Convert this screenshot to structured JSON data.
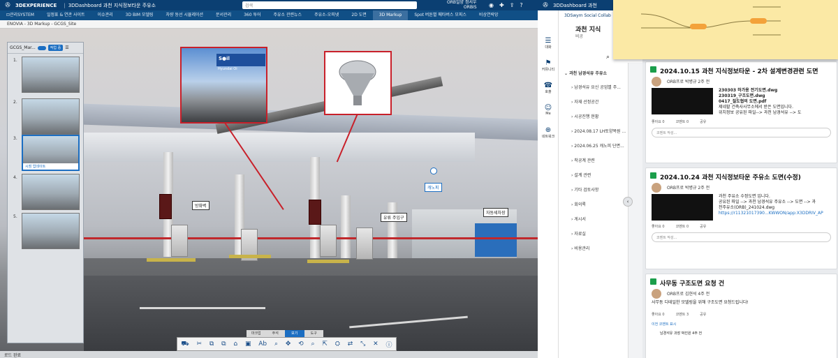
{
  "left_app": {
    "brand": "3DEXPERIENCE",
    "sep": "|",
    "dashboard": "3DDashboard 과천 지식정보타운 주유소",
    "search_placeholder": "검색",
    "user_line1": "ORB일양 정서우",
    "user_line2": "ORBIS",
    "tabs": [
      "⊡관리SYSTEM",
      "일정표 & 연관 사이트",
      "이슈관리",
      "3D BIM 모델링",
      "차량 동선 시뮬레이션",
      "문서관리",
      "360 투어",
      "주유소 관련뉴스",
      "주유소-오피넷",
      "2D 도면",
      "3D Markup",
      "Spot 버튼별 메타버스 모피스",
      "비상연락망"
    ],
    "active_tab": "3D Markup",
    "breadcrumb": "ENOVIA - 3D Markup - GCGS_Site",
    "panel_title": "GCGS_Mar...",
    "panel_button": "작업 중",
    "thumbs": [
      {
        "num": "1."
      },
      {
        "num": "2."
      },
      {
        "num": "3.",
        "caption": "시점 업데이트"
      },
      {
        "num": "4."
      },
      {
        "num": "5."
      }
    ],
    "labels": {
      "firewall": "방화벽",
      "canopy": "캐노피",
      "inlet": "유류 주입구",
      "carwash": "자동세차장"
    },
    "callout_station_sign": "S●il",
    "callout_station_brand": "Hyundai Oi",
    "toolbar_tabs": [
      "마크업",
      "주석",
      "보기",
      "도구"
    ],
    "active_toolbar_tab": "보기",
    "toolbar_icons": [
      "⛟",
      "✂",
      "⧉",
      "⧉",
      "⌂",
      "▣",
      "Ab",
      "⌕",
      "✥",
      "⟲",
      "⌕",
      "⇱",
      "⛭",
      "⇄",
      "⤡",
      "✕",
      "ⓘ"
    ],
    "status": "로드 완료"
  },
  "right_app": {
    "topbar_title": "3DDashboard 과천",
    "social_title": "3DSwym Social Collab",
    "community_title": "과천 지식",
    "community_sub": "비공",
    "rail": [
      {
        "icon": "☰",
        "label": "대화"
      },
      {
        "icon": "⚑",
        "label": "커뮤니티"
      },
      {
        "icon": "☎",
        "label": "호출"
      },
      {
        "icon": "☺",
        "label": "Me"
      },
      {
        "icon": "⊕",
        "label": "네트워크"
      }
    ],
    "nav_root": "과천 남경석유 주유소",
    "nav_items": [
      "남경석유 요신 공업별 주...",
      "자재 선정공간",
      "시공진행 현황",
      "2024.08.17 LH토양복원 ...",
      "2024.06.25 캐노피 단면...",
      "착공계 관련",
      "설계 관련",
      "기타 검토사항",
      "회의록",
      "게시서",
      "자료실",
      "비용관리"
    ],
    "posts": [
      {
        "title": "2024.10.15 과천 지식정보타운 - 2차 설계변경관련 도면",
        "author": "ORB프로 박병규",
        "time": "2주 전",
        "lines": [
          "230303 하가용 전기도면.dwg",
          "230319_구조도면.dwg",
          "0417_질도협의 도면.pdf",
          "제네할 건축사사무소에서 받은 도면입니다.",
          "위치정보 공유된 파일--> 과천 남경석유 --> 도"
        ],
        "likes": "좋아요 0",
        "comments": "코멘트 0",
        "share": "공유",
        "comment_placeholder": "코멘트 작성..."
      },
      {
        "title": "2024.10.24 과천 지식정보타운 주유소 도면(수정)",
        "author": "ORB프로 박병규",
        "time": "2주 전",
        "lines": [
          "과천 주유소 수정도면 입니다.",
          "공유된 파일 --> 과천 남경석유 주유소 --> 도면 --> 과",
          "천주유소(ORB)_241024.dwg"
        ],
        "link": "https://r1132101739​0...KWWON/app:X3DDRIV_AP",
        "likes": "좋아요 0",
        "comments": "코멘트 0",
        "share": "공유",
        "comment_placeholder": "코멘트 작성..."
      },
      {
        "title": "사무동 구조도면 요청 건",
        "author": "ORB프로 김현석",
        "time": "4주 전",
        "lines": [
          "사무동 디테일한 모델링을 위해 구조도면 요청드립니다!"
        ],
        "likes": "좋아요 0",
        "comments": "코멘트 3",
        "share": "공유",
        "prev_comments": "이전 코멘트 표시",
        "reply_author": "남경석유 과장 박진원",
        "reply_time": "4주 전"
      }
    ]
  },
  "colors": {
    "topbar": "#0b3f72",
    "accent": "#1b6ec2",
    "markup_red": "#c8202a",
    "post_icon": "#1b9e4b"
  }
}
